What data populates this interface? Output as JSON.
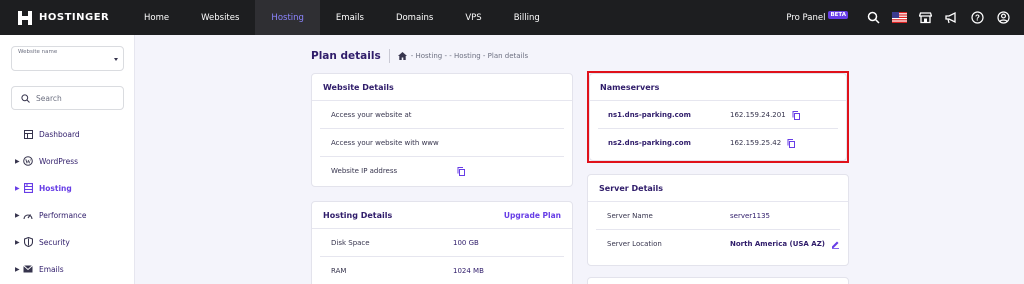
{
  "brand": {
    "name": "HOSTINGER"
  },
  "nav": {
    "items": [
      {
        "label": "Home",
        "active": false
      },
      {
        "label": "Websites",
        "active": false
      },
      {
        "label": "Hosting",
        "active": true
      },
      {
        "label": "Emails",
        "active": false
      },
      {
        "label": "Domains",
        "active": false
      },
      {
        "label": "VPS",
        "active": false
      },
      {
        "label": "Billing",
        "active": false
      }
    ],
    "pro_panel": "Pro Panel",
    "beta": "BETA"
  },
  "sidebar": {
    "website_select_label": "Website name",
    "search_placeholder": "Search",
    "items": [
      {
        "label": "Dashboard",
        "icon": "dashboard-icon",
        "expandable": false,
        "active": false
      },
      {
        "label": "WordPress",
        "icon": "wordpress-icon",
        "expandable": true,
        "active": false
      },
      {
        "label": "Hosting",
        "icon": "hosting-icon",
        "expandable": true,
        "active": true
      },
      {
        "label": "Performance",
        "icon": "performance-icon",
        "expandable": true,
        "active": false
      },
      {
        "label": "Security",
        "icon": "shield-icon",
        "expandable": true,
        "active": false
      },
      {
        "label": "Emails",
        "icon": "mail-icon",
        "expandable": true,
        "active": false
      }
    ]
  },
  "page": {
    "title": "Plan details",
    "breadcrumb": "- Hosting -  - Hosting - Plan details"
  },
  "website_details": {
    "title": "Website Details",
    "rows": [
      {
        "label": "Access your website at"
      },
      {
        "label": "Access your website with www"
      },
      {
        "label": "Website IP address"
      }
    ]
  },
  "hosting_details": {
    "title": "Hosting Details",
    "upgrade_label": "Upgrade Plan",
    "rows": [
      {
        "label": "Disk Space",
        "value": "100 GB"
      },
      {
        "label": "RAM",
        "value": "1024 MB"
      }
    ]
  },
  "nameservers": {
    "title": "Nameservers",
    "rows": [
      {
        "name": "ns1.dns-parking.com",
        "ip": "162.159.24.201"
      },
      {
        "name": "ns2.dns-parking.com",
        "ip": "162.159.25.42"
      }
    ]
  },
  "server_details": {
    "title": "Server Details",
    "rows": [
      {
        "label": "Server Name",
        "value": "server1135"
      },
      {
        "label": "Server Location",
        "value": "North America (USA AZ)"
      }
    ]
  },
  "colors": {
    "accent": "#673de6",
    "highlight": "#e0111a",
    "topbar": "#1d1e20"
  }
}
